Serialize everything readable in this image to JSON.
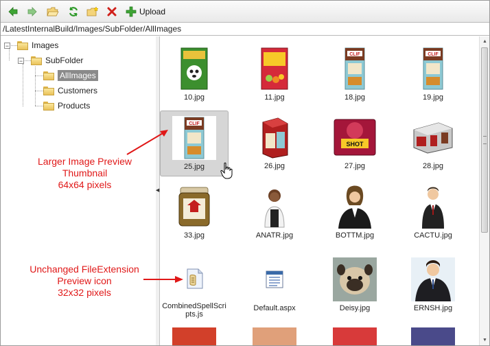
{
  "toolbar": {
    "buttons": [
      "back-icon",
      "forward-icon",
      "open-folder-icon",
      "refresh-icon",
      "new-folder-icon",
      "delete-icon"
    ],
    "upload_label": "Upload"
  },
  "path": "/LatestInternalBuild/Images/SubFolder/AllImages",
  "tree": {
    "root": "Images",
    "subfolder": "SubFolder",
    "children": [
      "AllImages",
      "Customers",
      "Products"
    ],
    "selected": "AllImages"
  },
  "files": [
    {
      "name": "10.jpg",
      "kind": "product-box-green"
    },
    {
      "name": "11.jpg",
      "kind": "product-box-red"
    },
    {
      "name": "18.jpg",
      "kind": "clif-bar"
    },
    {
      "name": "19.jpg",
      "kind": "clif-bar"
    },
    {
      "name": "25.jpg",
      "kind": "clif-bar"
    },
    {
      "name": "26.jpg",
      "kind": "clif-box"
    },
    {
      "name": "27.jpg",
      "kind": "shot-bloks"
    },
    {
      "name": "28.jpg",
      "kind": "clif-case"
    },
    {
      "name": "33.jpg",
      "kind": "jar"
    },
    {
      "name": "ANATR.jpg",
      "kind": "person-woman"
    },
    {
      "name": "BOTTM.jpg",
      "kind": "person-woman2"
    },
    {
      "name": "CACTU.jpg",
      "kind": "person-man"
    },
    {
      "name": "CombinedSpellScripts.js",
      "kind": "script-file"
    },
    {
      "name": "Default.aspx",
      "kind": "aspx-file"
    },
    {
      "name": "Deisy.jpg",
      "kind": "dog"
    },
    {
      "name": "ERNSH.jpg",
      "kind": "person-man2"
    }
  ],
  "selected_file": "25.jpg",
  "annotations": {
    "preview": [
      "Larger Image Preview",
      "Thumbnail",
      "64x64 pixels"
    ],
    "icon": [
      "Unchanged FileExtension",
      "Preview icon",
      "32x32 pixels"
    ]
  },
  "colors": {
    "annotation": "#e01818",
    "selection": "#d6d6d6"
  }
}
